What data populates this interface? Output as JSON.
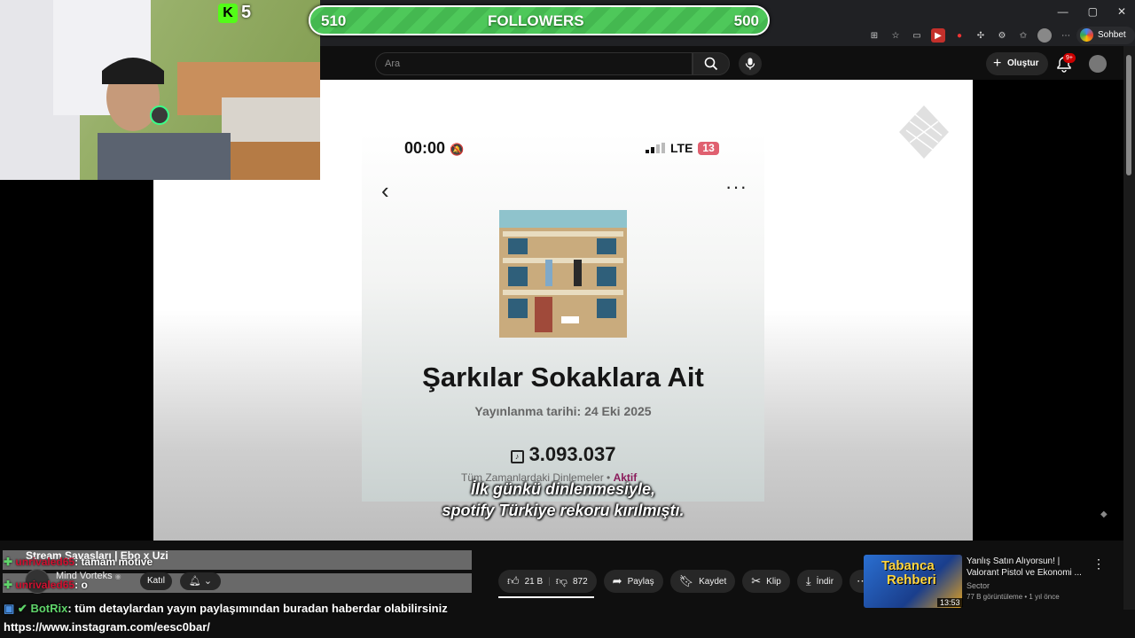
{
  "browser": {
    "chat_button": "Sohbet et",
    "window_controls": [
      "—",
      "▢",
      "✕"
    ]
  },
  "youtube": {
    "search_placeholder": "Ara",
    "create_label": "Oluştur",
    "notification_count": "9+"
  },
  "stream_overlay": {
    "kick_count": "5",
    "followers_current": "510",
    "followers_label": "FOLLOWERS",
    "followers_goal": "500"
  },
  "video": {
    "phone_time": "00:00",
    "network": "LTE",
    "battery": "13",
    "song_title": "Şarkılar Sokaklara Ait",
    "release_date": "Yayınlanma tarihi: 24 Eki 2025",
    "play_count": "3.093.037",
    "alltime_label": "Tüm Zamanlardaki Dinlemeler",
    "alltime_status": "Aktif",
    "subtitle_line1": "İlk günkü dinlenmesiyle,",
    "subtitle_line2": "spotify Türkiye rekoru kırılmıştı."
  },
  "chat": {
    "video_title": "Stream Savaşları | Ebo x Uzi",
    "messages": [
      {
        "user": "unrivaled65",
        "text": ": tamam motive"
      },
      {
        "user": "unrivaled65",
        "text": ": o"
      }
    ],
    "bot_user": "BotRix",
    "bot_text": ": tüm detaylardan yayın paylaşımından buradan haberdar olabilirsiniz",
    "link": "https://www.instagram.com/eesc0bar/"
  },
  "channel": {
    "name": "Mind Vorteks",
    "join_label": "Katıl"
  },
  "actions": {
    "likes": "21 B",
    "dislikes": "872",
    "share": "Paylaş",
    "save": "Kaydet",
    "clip": "Klip",
    "download": "İndir"
  },
  "recommended": {
    "thumb_line1": "Tabanca",
    "thumb_line2": "Rehberi",
    "duration": "13:53",
    "title": "Yanlış Satın Alıyorsun! | Valorant Pistol ve Ekonomi ...",
    "channel": "Sector",
    "meta": "77 B görüntüleme • 1 yıl önce"
  }
}
